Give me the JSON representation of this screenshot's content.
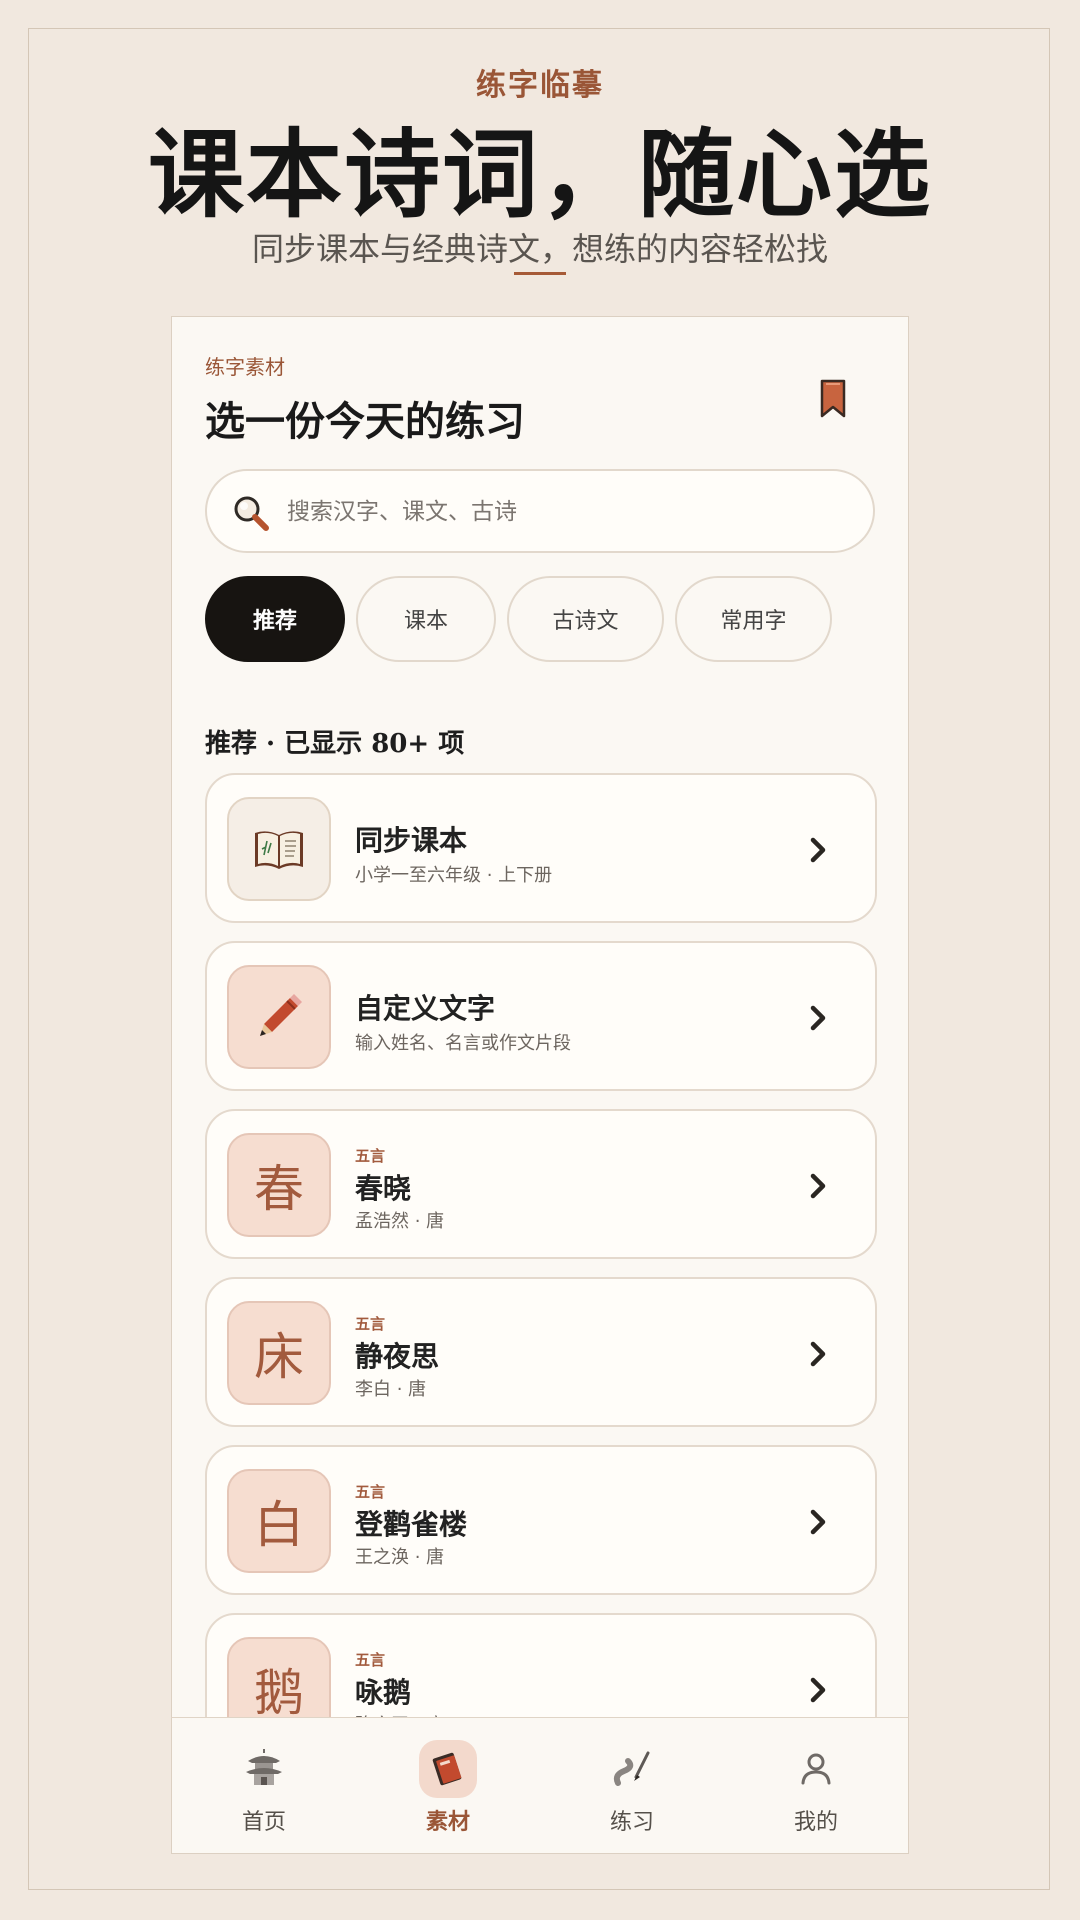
{
  "header": {
    "brand": "练字临摹",
    "headline": "课本诗词，随心选",
    "subtitle": "同步课本与经典诗文，想练的内容轻松找"
  },
  "panel": {
    "eyebrow": "练字素材",
    "title": "选一份今天的练习",
    "bookmark_icon": "bookmark-icon"
  },
  "search": {
    "placeholder": "搜索汉字、课文、古诗",
    "value": ""
  },
  "chips": [
    {
      "label": "推荐",
      "active": true
    },
    {
      "label": "课本",
      "active": false
    },
    {
      "label": "古诗文",
      "active": false
    },
    {
      "label": "常用字",
      "active": false
    }
  ],
  "section": {
    "label": "推荐 · 已显示 80+ 项"
  },
  "items": [
    {
      "title": "同步课本",
      "subtitle": "小学一至六年级 · 上下册",
      "icon": "open-book-icon"
    },
    {
      "title": "自定义文字",
      "subtitle": "输入姓名、名言或作文片段",
      "icon": "pencil-icon"
    },
    {
      "tag": "五言",
      "title": "春晓",
      "subtitle": "孟浩然 · 唐",
      "char": "春"
    },
    {
      "tag": "五言",
      "title": "静夜思",
      "subtitle": "李白 · 唐",
      "char": "床"
    },
    {
      "tag": "五言",
      "title": "登鹳雀楼",
      "subtitle": "王之涣 · 唐",
      "char": "白"
    },
    {
      "tag": "五言",
      "title": "咏鹅",
      "subtitle": "骆宾王 · 唐",
      "char": "鹅"
    }
  ],
  "nav": [
    {
      "label": "首页",
      "icon": "pagoda-icon",
      "active": false
    },
    {
      "label": "素材",
      "icon": "book-icon",
      "active": true
    },
    {
      "label": "练习",
      "icon": "brush-icon",
      "active": false
    },
    {
      "label": "我的",
      "icon": "user-icon",
      "active": false
    }
  ],
  "colors": {
    "background": "#f1e8df",
    "accent": "#9a5637",
    "chip_active": "#171411",
    "card_thumb_warm": "#f6ddd0"
  }
}
